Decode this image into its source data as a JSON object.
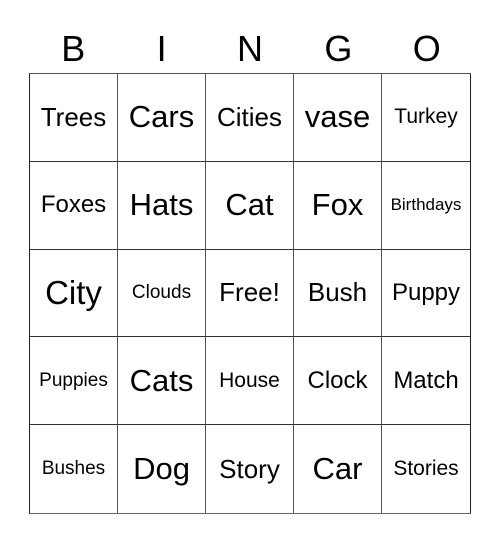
{
  "header": {
    "letters": [
      "B",
      "I",
      "N",
      "G",
      "O"
    ]
  },
  "cells": [
    [
      "Trees",
      "Cars",
      "Cities",
      "vase",
      "Turkey"
    ],
    [
      "Foxes",
      "Hats",
      "Cat",
      "Fox",
      "Birthdays"
    ],
    [
      "City",
      "Clouds",
      "Free!",
      "Bush",
      "Puppy"
    ],
    [
      "Puppies",
      "Cats",
      "House",
      "Clock",
      "Match"
    ],
    [
      "Bushes",
      "Dog",
      "Story",
      "Car",
      "Stories"
    ]
  ],
  "free_space": {
    "row": 2,
    "col": 2,
    "label": "Free!"
  }
}
